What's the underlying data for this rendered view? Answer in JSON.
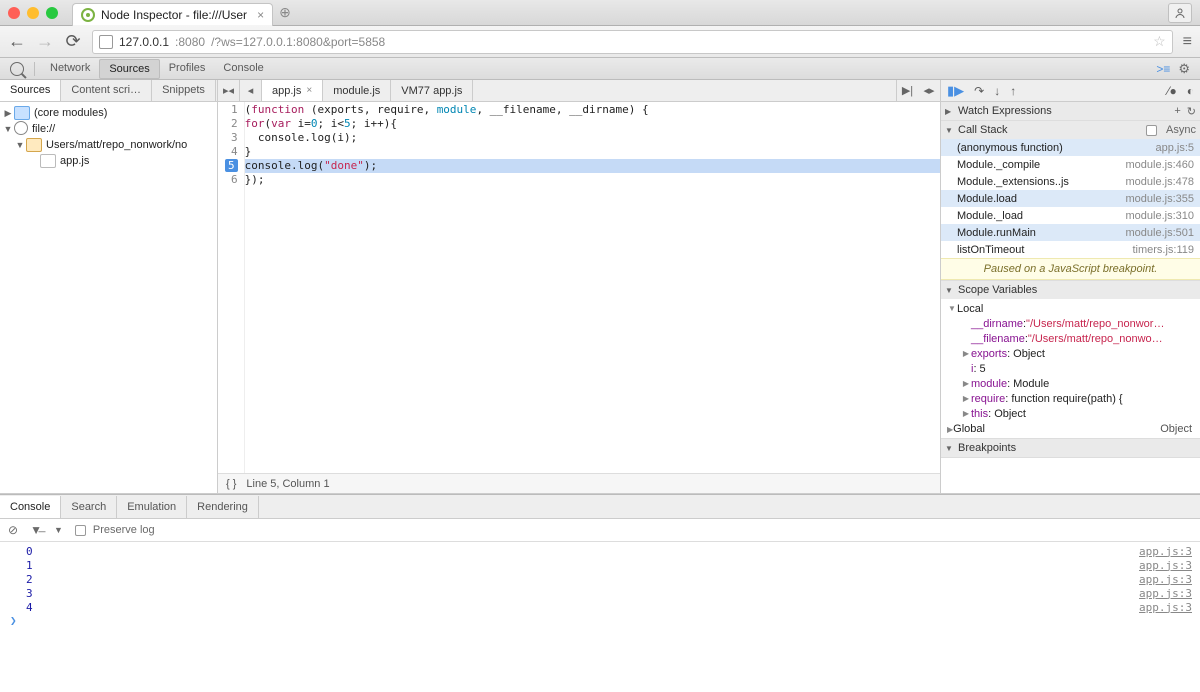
{
  "window": {
    "tab_title": "Node Inspector - file:///User",
    "url_host": "127.0.0.1",
    "url_port": ":8080",
    "url_path": "/?ws=127.0.0.1:8080&port=5858"
  },
  "devtools_tabs": [
    "Network",
    "Sources",
    "Profiles",
    "Console"
  ],
  "devtools_active": "Sources",
  "nav_tabs": [
    "Sources",
    "Content scri…",
    "Snippets"
  ],
  "nav_active": "Sources",
  "tree": {
    "core": "(core modules)",
    "file_scheme": "file://",
    "folder": "Users/matt/repo_nonwork/no",
    "file": "app.js"
  },
  "open_files": [
    {
      "name": "app.js",
      "closable": true,
      "active": true
    },
    {
      "name": "module.js",
      "closable": false,
      "active": false
    },
    {
      "name": "VM77 app.js",
      "closable": false,
      "active": false
    }
  ],
  "code_lines": [
    "(function (exports, require, module, __filename, __dirname) {",
    "for(var i=0; i<5; i++){",
    "  console.log(i);",
    "}",
    "console.log(\"done\");",
    "});"
  ],
  "breakpoint_line": 5,
  "highlight_line": 5,
  "cursor_status": "Line 5, Column 1",
  "right": {
    "watch_label": "Watch Expressions",
    "callstack_label": "Call Stack",
    "async_label": "Async",
    "paused_msg": "Paused on a JavaScript breakpoint.",
    "callstack": [
      {
        "fn": "(anonymous function)",
        "loc": "app.js:5",
        "sel": true
      },
      {
        "fn": "Module._compile",
        "loc": "module.js:460"
      },
      {
        "fn": "Module._extensions..js",
        "loc": "module.js:478"
      },
      {
        "fn": "Module.load",
        "loc": "module.js:355",
        "sel": true
      },
      {
        "fn": "Module._load",
        "loc": "module.js:310"
      },
      {
        "fn": "Module.runMain",
        "loc": "module.js:501",
        "sel": true
      },
      {
        "fn": "listOnTimeout",
        "loc": "timers.js:119"
      }
    ],
    "scope_label": "Scope Variables",
    "local_label": "Local",
    "global_label": "Global",
    "global_val": "Object",
    "scope_local": [
      {
        "k": "__dirname",
        "v": "\"/Users/matt/repo_nonwor…",
        "str": true
      },
      {
        "k": "__filename",
        "v": "\"/Users/matt/repo_nonwo…",
        "str": true
      },
      {
        "k": "exports",
        "v": "Object",
        "exp": true
      },
      {
        "k": "i",
        "v": "5"
      },
      {
        "k": "module",
        "v": "Module",
        "exp": true
      },
      {
        "k": "require",
        "v": "function require(path) {",
        "exp": true
      },
      {
        "k": "this",
        "v": "Object",
        "exp": true
      }
    ],
    "breakpoints_label": "Breakpoints"
  },
  "drawer_tabs": [
    "Console",
    "Search",
    "Emulation",
    "Rendering"
  ],
  "drawer_active": "Console",
  "preserve_label": "Preserve log",
  "console_lines": [
    {
      "v": "0",
      "src": "app.js:3"
    },
    {
      "v": "1",
      "src": "app.js:3"
    },
    {
      "v": "2",
      "src": "app.js:3"
    },
    {
      "v": "3",
      "src": "app.js:3"
    },
    {
      "v": "4",
      "src": "app.js:3"
    }
  ]
}
